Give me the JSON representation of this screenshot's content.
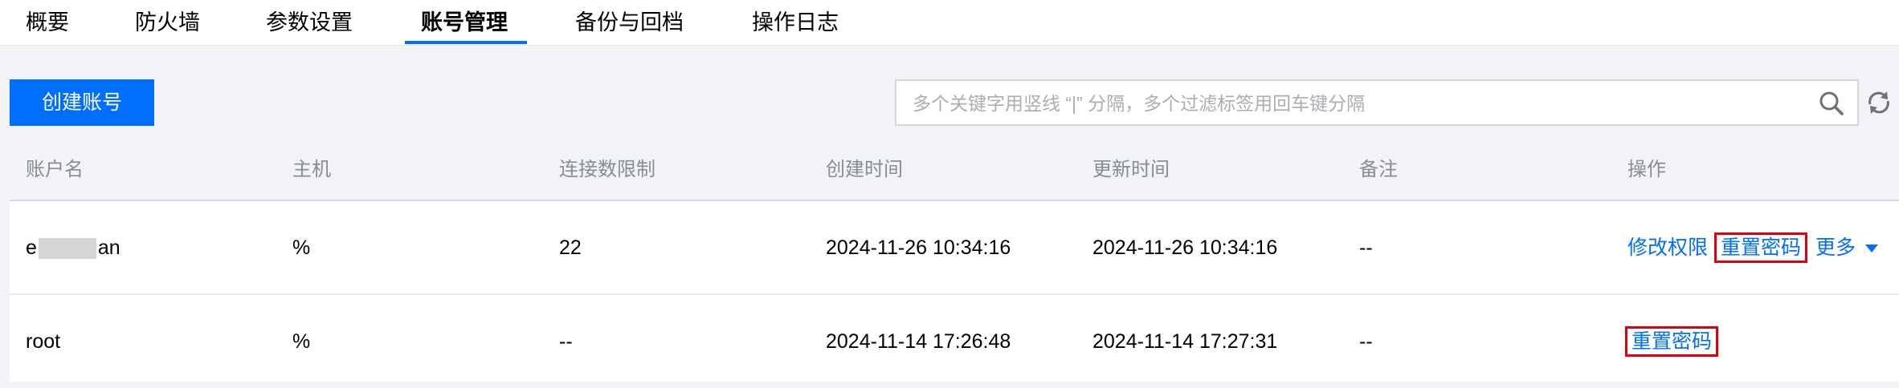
{
  "tabs": [
    {
      "label": "概要",
      "active": false
    },
    {
      "label": "防火墙",
      "active": false
    },
    {
      "label": "参数设置",
      "active": false
    },
    {
      "label": "账号管理",
      "active": true
    },
    {
      "label": "备份与回档",
      "active": false
    },
    {
      "label": "操作日志",
      "active": false
    }
  ],
  "toolbar": {
    "create_label": "创建账号",
    "search_placeholder": "多个关键字用竖线 “|” 分隔，多个过滤标签用回车键分隔",
    "search_icon": "search-icon",
    "refresh_icon": "refresh-icon"
  },
  "table": {
    "columns": [
      "账户名",
      "主机",
      "连接数限制",
      "创建时间",
      "更新时间",
      "备注",
      "操作"
    ],
    "rows": [
      {
        "account_prefix": "e",
        "account_suffix": "an",
        "host": "%",
        "conn_limit": "22",
        "created": "2024-11-26 10:34:16",
        "updated": "2024-11-26 10:34:16",
        "remark": "--",
        "actions": {
          "modify": "修改权限",
          "reset": "重置密码",
          "more": "更多"
        }
      },
      {
        "account": "root",
        "host": "%",
        "conn_limit": "--",
        "created": "2024-11-14 17:26:48",
        "updated": "2024-11-14 17:27:31",
        "remark": "--",
        "actions": {
          "reset": "重置密码"
        }
      }
    ]
  },
  "colors": {
    "accent": "#006eff",
    "highlight": "#e0000c",
    "header_bg": "#f2f3f7"
  }
}
